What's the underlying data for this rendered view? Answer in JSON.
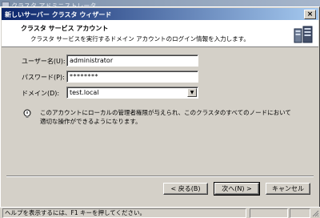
{
  "background_window": {
    "title": "クラスタ アドミニストレータ"
  },
  "dialog": {
    "title": "新しいサーバー クラスタ ウィザード",
    "close_symbol": "×",
    "header_title": "クラスタ サービス アカウント",
    "header_subtitle": "クラスタ サービスを実行するドメイン アカウントのログイン情報を入力します。",
    "icon": "cluster-servers-icon"
  },
  "form": {
    "username_label": "ユーザー名(U):",
    "username_value": "administrator",
    "password_label": "パスワード(P):",
    "password_value": "********",
    "domain_label": "ドメイン(D):",
    "domain_value": "test.local"
  },
  "info": {
    "icon": "info-bulb-icon",
    "text": "このアカウントにローカルの管理者権限が与えられ、このクラスタのすべてのノードにおいて適切な操作ができるようになります。"
  },
  "buttons": {
    "back": "< 戻る(B)",
    "next": "次へ(N) >",
    "cancel": "キャンセル"
  },
  "statusbar": {
    "text": "ヘルプを表示するには、F1 キーを押してください。"
  }
}
